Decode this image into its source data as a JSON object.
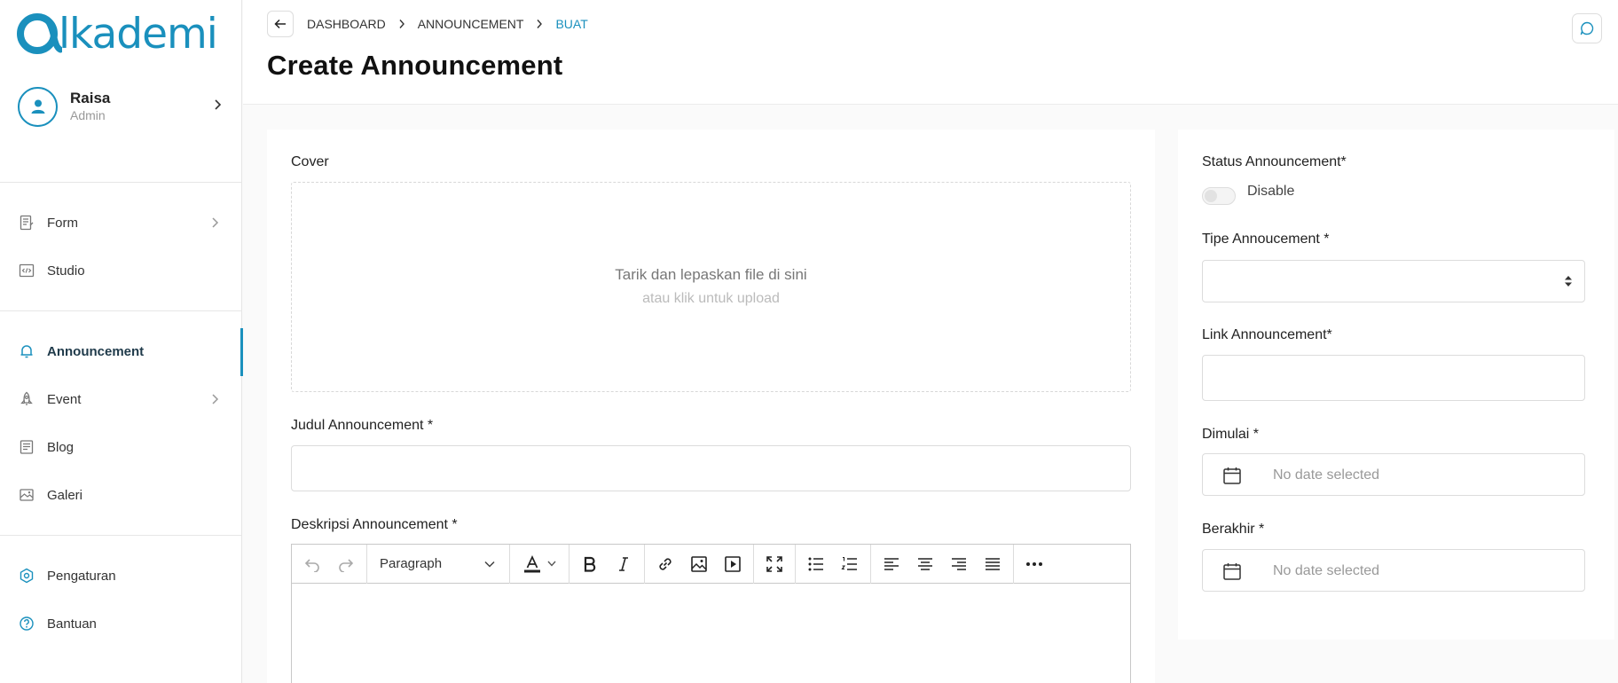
{
  "brand": {
    "logo_text": "lkademi",
    "accent": "#1a90bd"
  },
  "user": {
    "name": "Raisa",
    "role": "Admin"
  },
  "sidebar": {
    "items": [
      {
        "label": "Form",
        "icon": "form-icon"
      },
      {
        "label": "Studio",
        "icon": "code-icon"
      },
      {
        "label": "Announcement",
        "icon": "bell-icon",
        "active": true
      },
      {
        "label": "Event",
        "icon": "rocket-icon"
      },
      {
        "label": "Blog",
        "icon": "blog-icon"
      },
      {
        "label": "Galeri",
        "icon": "gallery-icon"
      },
      {
        "label": "Pengaturan",
        "icon": "settings-icon"
      },
      {
        "label": "Bantuan",
        "icon": "help-icon"
      }
    ]
  },
  "breadcrumb": {
    "items": [
      "DASHBOARD",
      "ANNOUNCEMENT",
      "BUAT"
    ]
  },
  "page": {
    "title": "Create Announcement"
  },
  "form": {
    "cover_label": "Cover",
    "dropzone_main": "Tarik dan lepaskan file di sini",
    "dropzone_sub": "atau klik untuk upload",
    "title_label": "Judul Announcement *",
    "title_value": "",
    "desc_label": "Deskripsi Announcement *",
    "editor_block": "Paragraph"
  },
  "side": {
    "status_label": "Status Announcement*",
    "status_value": "Disable",
    "type_label": "Tipe Annoucement *",
    "type_value": "",
    "link_label": "Link Announcement*",
    "link_value": "",
    "start_label": "Dimulai *",
    "start_placeholder": "No date selected",
    "end_label": "Berakhir *",
    "end_placeholder": "No date selected"
  }
}
